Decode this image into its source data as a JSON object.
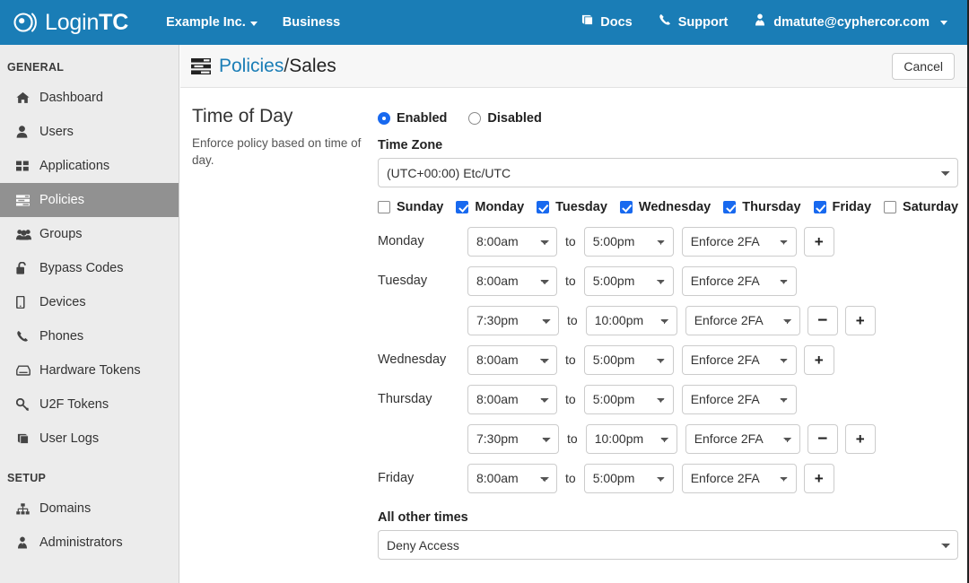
{
  "navbar": {
    "brand_light": "Login",
    "brand_bold": "TC",
    "brand_logo_icon": "lightc-signal-logo",
    "left_items": [
      {
        "label": "Example Inc.",
        "has_caret": true
      },
      {
        "label": "Business",
        "has_caret": false
      }
    ],
    "right_items": [
      {
        "label": "Docs",
        "icon": "book-icon",
        "glyph": "☰",
        "has_caret": false
      },
      {
        "label": "Support",
        "icon": "phone-icon",
        "glyph": "☎",
        "has_caret": false
      },
      {
        "label": "dmatute@cyphercor.com",
        "icon": "user-tie-icon",
        "glyph": "♟",
        "has_caret": true
      }
    ]
  },
  "sidebar": {
    "sections": [
      {
        "heading": "GENERAL",
        "items": [
          {
            "label": "Dashboard",
            "icon": "home-icon",
            "active": false
          },
          {
            "label": "Users",
            "icon": "user-icon",
            "active": false
          },
          {
            "label": "Applications",
            "icon": "grid-icon",
            "active": false
          },
          {
            "label": "Policies",
            "icon": "policies-list-icon",
            "active": true
          },
          {
            "label": "Groups",
            "icon": "users-group-icon",
            "active": false
          },
          {
            "label": "Bypass Codes",
            "icon": "unlock-icon",
            "active": false
          },
          {
            "label": "Devices",
            "icon": "mobile-icon",
            "active": false
          },
          {
            "label": "Phones",
            "icon": "phone-icon",
            "active": false
          },
          {
            "label": "Hardware Tokens",
            "icon": "hardware-token-icon",
            "active": false
          },
          {
            "label": "U2F Tokens",
            "icon": "key-icon",
            "active": false
          },
          {
            "label": "User Logs",
            "icon": "book-icon",
            "active": false
          }
        ]
      },
      {
        "heading": "SETUP",
        "items": [
          {
            "label": "Domains",
            "icon": "sitemap-icon",
            "active": false
          },
          {
            "label": "Administrators",
            "icon": "user-tie-icon",
            "active": false
          }
        ]
      }
    ]
  },
  "page_header": {
    "icon": "policies-list-icon",
    "crumb_parent": "Policies",
    "crumb_separator": "/",
    "crumb_current": "Sales",
    "cancel_label": "Cancel"
  },
  "section": {
    "title": "Time of Day",
    "description": "Enforce policy based on time of day."
  },
  "toggle": {
    "enabled_label": "Enabled",
    "disabled_label": "Disabled",
    "selected": "Enabled"
  },
  "timezone": {
    "label": "Time Zone",
    "value": "(UTC+00:00) Etc/UTC"
  },
  "days": [
    {
      "label": "Sunday",
      "checked": false
    },
    {
      "label": "Monday",
      "checked": true
    },
    {
      "label": "Tuesday",
      "checked": true
    },
    {
      "label": "Wednesday",
      "checked": true
    },
    {
      "label": "Thursday",
      "checked": true
    },
    {
      "label": "Friday",
      "checked": true
    },
    {
      "label": "Saturday",
      "checked": false
    }
  ],
  "schedule": {
    "to_label": "to",
    "add_label": "+",
    "remove_label": "−",
    "rows": [
      {
        "day": "Monday",
        "from": "8:00am",
        "to": "5:00pm",
        "action": "Enforce 2FA",
        "has_remove": false,
        "has_add": true
      },
      {
        "day": "Tuesday",
        "from": "8:00am",
        "to": "5:00pm",
        "action": "Enforce 2FA",
        "has_remove": false,
        "has_add": false
      },
      {
        "day": "",
        "from": "7:30pm",
        "to": "10:00pm",
        "action": "Enforce 2FA",
        "has_remove": true,
        "has_add": true
      },
      {
        "day": "Wednesday",
        "from": "8:00am",
        "to": "5:00pm",
        "action": "Enforce 2FA",
        "has_remove": false,
        "has_add": true
      },
      {
        "day": "Thursday",
        "from": "8:00am",
        "to": "5:00pm",
        "action": "Enforce 2FA",
        "has_remove": false,
        "has_add": false
      },
      {
        "day": "",
        "from": "7:30pm",
        "to": "10:00pm",
        "action": "Enforce 2FA",
        "has_remove": true,
        "has_add": true
      },
      {
        "day": "Friday",
        "from": "8:00am",
        "to": "5:00pm",
        "action": "Enforce 2FA",
        "has_remove": false,
        "has_add": true
      }
    ]
  },
  "all_other_times": {
    "label": "All other times",
    "value": "Deny Access"
  },
  "colors": {
    "brand_blue": "#1a7db6",
    "link_blue": "#1a7db6",
    "accent_blue": "#1869ef",
    "sidebar_bg": "#ececec",
    "sidebar_active": "#919191"
  }
}
